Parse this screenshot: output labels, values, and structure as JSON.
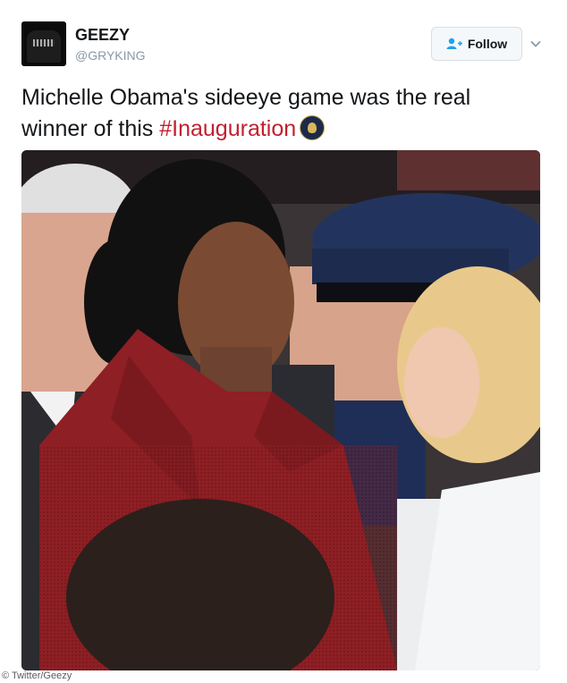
{
  "user": {
    "name": "GEEZY",
    "handle": "@GRYKING",
    "avatar_icon": "avatar-hoodie"
  },
  "follow_button": {
    "label": "Follow",
    "icon": "add-person-icon"
  },
  "caret_icon": "chevron-down-icon",
  "tweet": {
    "text_before": "Michelle Obama's sideeye game was the real winner of this ",
    "hashtag": "#Inauguration",
    "emoji": "presidential-seal-emoji"
  },
  "photo_credit": "© Twitter/Geezy",
  "colors": {
    "hashtag": "#c21f2f",
    "follow_bg": "#f5f8fa",
    "coat_red": "#8e1f24",
    "uniform_blue": "#1f2e56",
    "white_coat": "#eceef0"
  }
}
